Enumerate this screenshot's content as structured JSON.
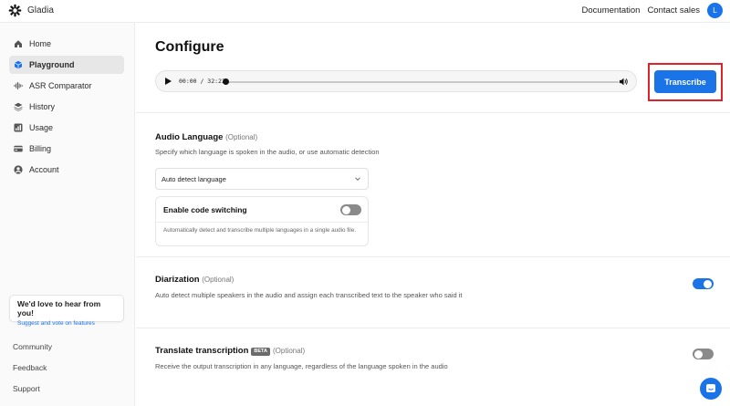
{
  "app": {
    "brand_name": "Gladia",
    "avatar_initial": "L"
  },
  "header": {
    "links": [
      "Documentation",
      "Contact sales"
    ]
  },
  "sidebar": {
    "items": [
      {
        "label": "Home",
        "icon": "home-icon",
        "active": false
      },
      {
        "label": "Playground",
        "icon": "cube-icon",
        "active": true
      },
      {
        "label": "ASR Comparator",
        "icon": "waveform-icon",
        "active": false
      },
      {
        "label": "History",
        "icon": "layers-icon",
        "active": false
      },
      {
        "label": "Usage",
        "icon": "bar-chart-icon",
        "active": false
      },
      {
        "label": "Billing",
        "icon": "credit-card-icon",
        "active": false
      },
      {
        "label": "Account",
        "icon": "user-circle-icon",
        "active": false
      }
    ],
    "feedback": {
      "title": "We'd love to hear from you!",
      "link": "Suggest and vote on features"
    },
    "footer_links": [
      "Community",
      "Feedback",
      "Support"
    ]
  },
  "main": {
    "title": "Configure",
    "player": {
      "time": "00:00 / 32:22",
      "progress": 0
    },
    "transcribe_label": "Transcribe",
    "audio_language": {
      "title": "Audio Language",
      "optional": "(Optional)",
      "description": "Specify which language is spoken in the audio, or use automatic detection",
      "selected": "Auto detect language",
      "code_switching": {
        "title": "Enable code switching",
        "description": "Automatically detect and transcribe multiple languages in a single audio file.",
        "enabled": false
      }
    },
    "diarization": {
      "title": "Diarization",
      "optional": "(Optional)",
      "description": "Auto detect multiple speakers in the audio and assign each transcribed text to the speaker who said it",
      "enabled": true
    },
    "translate": {
      "title": "Translate transcription",
      "badge": "BETA",
      "optional": "(Optional)",
      "description": "Receive the output transcription in any language, regardless of the language spoken in the audio",
      "enabled": false
    }
  },
  "colors": {
    "accent": "#1b73e8",
    "highlight_border": "#e0232b",
    "toggle_off": "#8a8a8a"
  }
}
